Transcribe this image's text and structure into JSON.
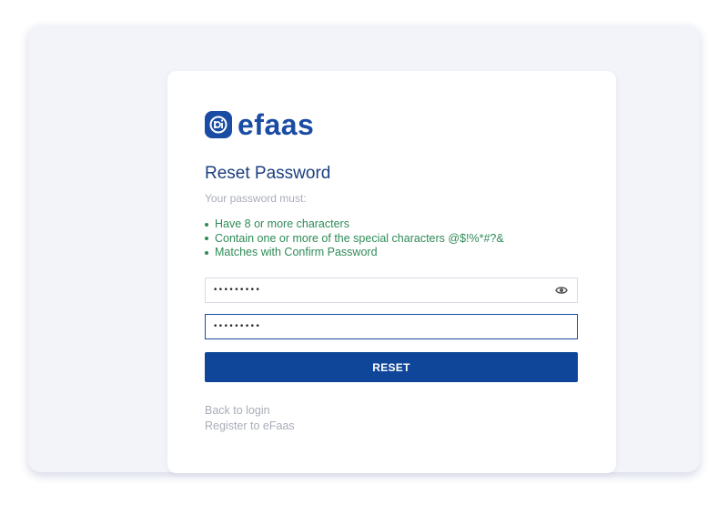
{
  "brand": {
    "name": "efaas",
    "color": "#1a4ca3"
  },
  "form": {
    "title": "Reset Password",
    "subtitle": "Your password must:",
    "rules": [
      "Have 8 or more characters",
      "Contain one or more of the special characters @$!%*#?&",
      "Matches with Confirm Password"
    ],
    "rule_color": "#2e8b57",
    "password": {
      "value": "•••••••••",
      "type": "password"
    },
    "confirm_password": {
      "value": "•••••••••",
      "type": "password",
      "focused": true
    },
    "reset_label": "RESET",
    "button_color": "#0f4699"
  },
  "links": {
    "back_to_login": "Back to login",
    "register": "Register to eFaas"
  },
  "icons": {
    "logo": "efaas-logo-icon",
    "show_password": "eye-icon"
  }
}
